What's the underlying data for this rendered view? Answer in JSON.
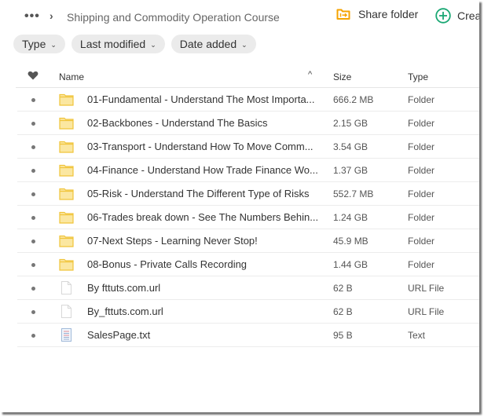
{
  "breadcrumb": {
    "more_label": "•••",
    "separator": "›",
    "current": "Shipping and Commodity Operation Course"
  },
  "actions": {
    "share_folder": "Share folder",
    "create": "Crea"
  },
  "filters": [
    {
      "label": "Type"
    },
    {
      "label": "Last modified"
    },
    {
      "label": "Date added"
    }
  ],
  "table": {
    "columns": {
      "name": "Name",
      "size": "Size",
      "type": "Type"
    },
    "sort_indicator": "^",
    "rows": [
      {
        "name": "01-Fundamental - Understand The Most Importa...",
        "size": "666.2 MB",
        "type": "Folder",
        "icon": "folder-icon"
      },
      {
        "name": "02-Backbones - Understand The Basics",
        "size": "2.15 GB",
        "type": "Folder",
        "icon": "folder-icon"
      },
      {
        "name": "03-Transport - Understand How To Move Comm...",
        "size": "3.54 GB",
        "type": "Folder",
        "icon": "folder-icon"
      },
      {
        "name": "04-Finance - Understand How Trade Finance Wo...",
        "size": "1.37 GB",
        "type": "Folder",
        "icon": "folder-icon"
      },
      {
        "name": "05-Risk - Understand The Different Type of Risks",
        "size": "552.7 MB",
        "type": "Folder",
        "icon": "folder-icon"
      },
      {
        "name": "06-Trades break down - See The Numbers Behin...",
        "size": "1.24 GB",
        "type": "Folder",
        "icon": "folder-icon"
      },
      {
        "name": "07-Next Steps - Learning Never Stop!",
        "size": "45.9 MB",
        "type": "Folder",
        "icon": "folder-icon"
      },
      {
        "name": "08-Bonus - Private Calls Recording",
        "size": "1.44 GB",
        "type": "Folder",
        "icon": "folder-icon"
      },
      {
        "name": "By fttuts.com.url",
        "size": "62 B",
        "type": "URL File",
        "icon": "file-icon"
      },
      {
        "name": "By_fttuts.com.url",
        "size": "62 B",
        "type": "URL File",
        "icon": "file-icon"
      },
      {
        "name": "SalesPage.txt",
        "size": "95 B",
        "type": "Text",
        "icon": "text-file-icon"
      }
    ]
  },
  "colors": {
    "share_icon": "#f5a300",
    "create_icon": "#1aa874",
    "folder_fill": "#fbe7a1",
    "folder_stroke": "#f0c43a"
  }
}
